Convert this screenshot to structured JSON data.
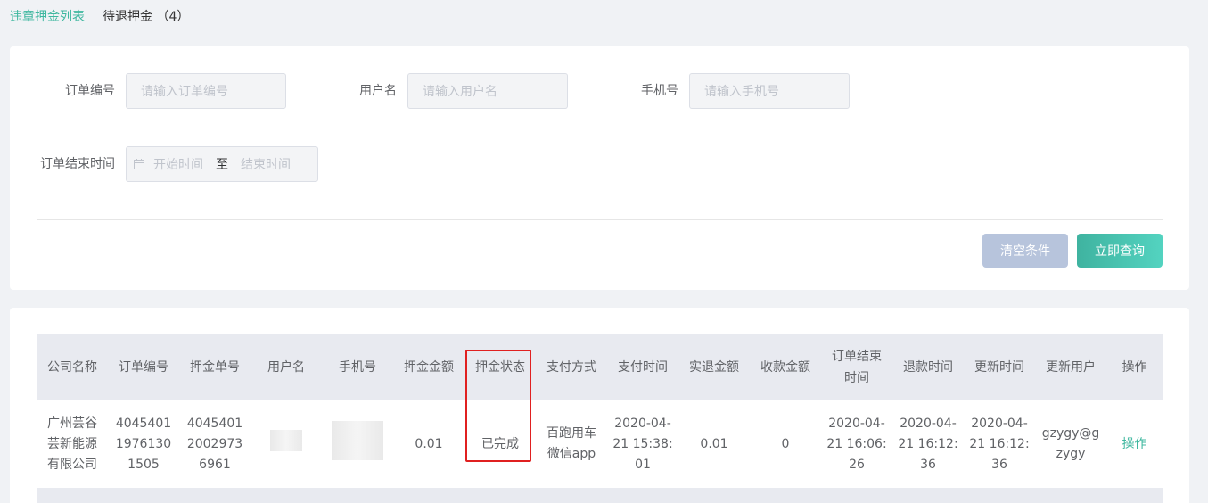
{
  "tabs": [
    {
      "label": "违章押金列表"
    },
    {
      "label": "待退押金 （4）"
    }
  ],
  "search": {
    "order_no_label": "订单编号",
    "order_no_placeholder": "请输入订单编号",
    "username_label": "用户名",
    "username_placeholder": "请输入用户名",
    "phone_label": "手机号",
    "phone_placeholder": "请输入手机号",
    "end_time_label": "订单结束时间",
    "start_placeholder": "开始时间",
    "range_sep": "至",
    "end_placeholder": "结束时间",
    "clear_label": "清空条件",
    "query_label": "立即查询"
  },
  "table": {
    "headers": [
      "公司名称",
      "订单编号",
      "押金单号",
      "用户名",
      "手机号",
      "押金金额",
      "押金状态",
      "支付方式",
      "支付时间",
      "实退金额",
      "收款金额",
      "订单结束时间",
      "退款时间",
      "更新时间",
      "更新用户",
      "操作"
    ],
    "rows": [
      {
        "company": "广州芸谷芸新能源有限公司",
        "order_no": "40454011976130 1505",
        "deposit_no": "40454012002973 6961",
        "amount": "0.01",
        "status": "已完成",
        "pay_method": "百跑用车微信app",
        "pay_time": "2020-04-21 15:38:01",
        "refund_amount": "0.01",
        "receive_amount": "0",
        "end_time": "2020-04-21 16:06:26",
        "refund_time": "2020-04-21 16:12:36",
        "update_time": "2020-04-21 16:12:36",
        "update_user": "gzygy@gzygy",
        "action": "操作"
      }
    ]
  }
}
